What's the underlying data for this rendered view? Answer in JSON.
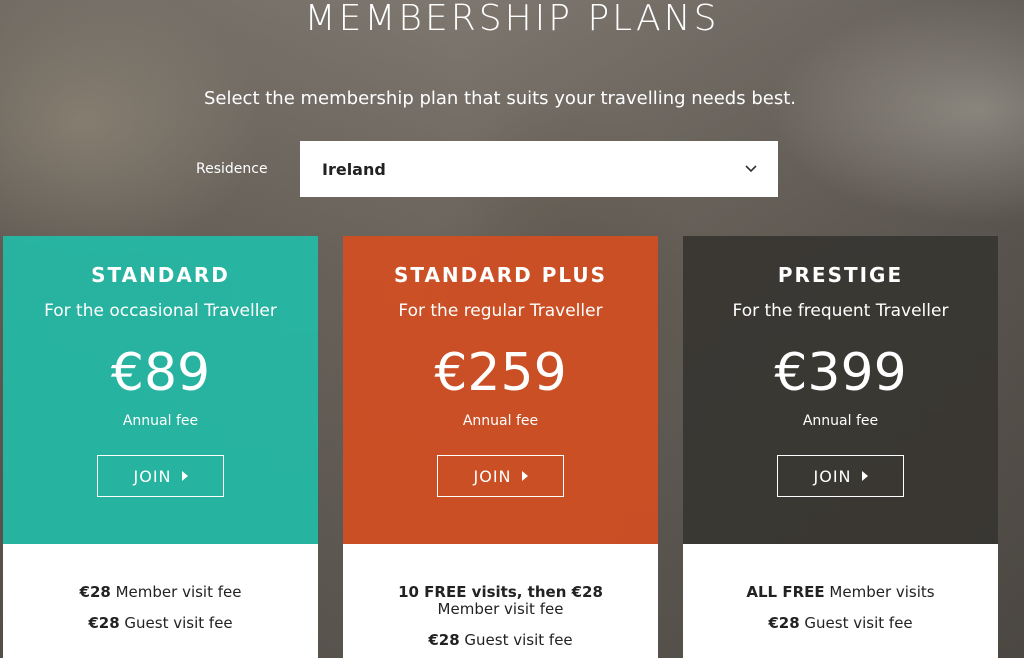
{
  "header": {
    "title": "MEMBERSHIP PLANS",
    "subtitle": "Select the membership plan that suits your travelling needs best."
  },
  "residence": {
    "label": "Residence",
    "value": "Ireland",
    "icon": "chevron-down-icon"
  },
  "colors": {
    "standard": "#22baa6",
    "standard_plus": "#d44e22",
    "prestige": "#383632"
  },
  "plans": [
    {
      "name": "STANDARD",
      "tagline": "For the occasional Traveller",
      "price": "€89",
      "fee_label": "Annual fee",
      "join_label": "JOIN",
      "features": [
        {
          "bold": "€28",
          "text": " Member visit fee"
        },
        {
          "bold": "€28",
          "text": " Guest visit fee"
        }
      ]
    },
    {
      "name": "STANDARD PLUS",
      "tagline": "For the regular Traveller",
      "price": "€259",
      "fee_label": "Annual fee",
      "join_label": "JOIN",
      "features": [
        {
          "bold": "10 FREE visits, then €28",
          "text": " Member visit fee"
        },
        {
          "bold": "€28",
          "text": " Guest visit fee"
        }
      ]
    },
    {
      "name": "PRESTIGE",
      "tagline": "For the frequent Traveller",
      "price": "€399",
      "fee_label": "Annual fee",
      "join_label": "JOIN",
      "features": [
        {
          "bold": "ALL FREE",
          "text": " Member visits"
        },
        {
          "bold": "€28",
          "text": " Guest visit fee"
        }
      ]
    }
  ]
}
